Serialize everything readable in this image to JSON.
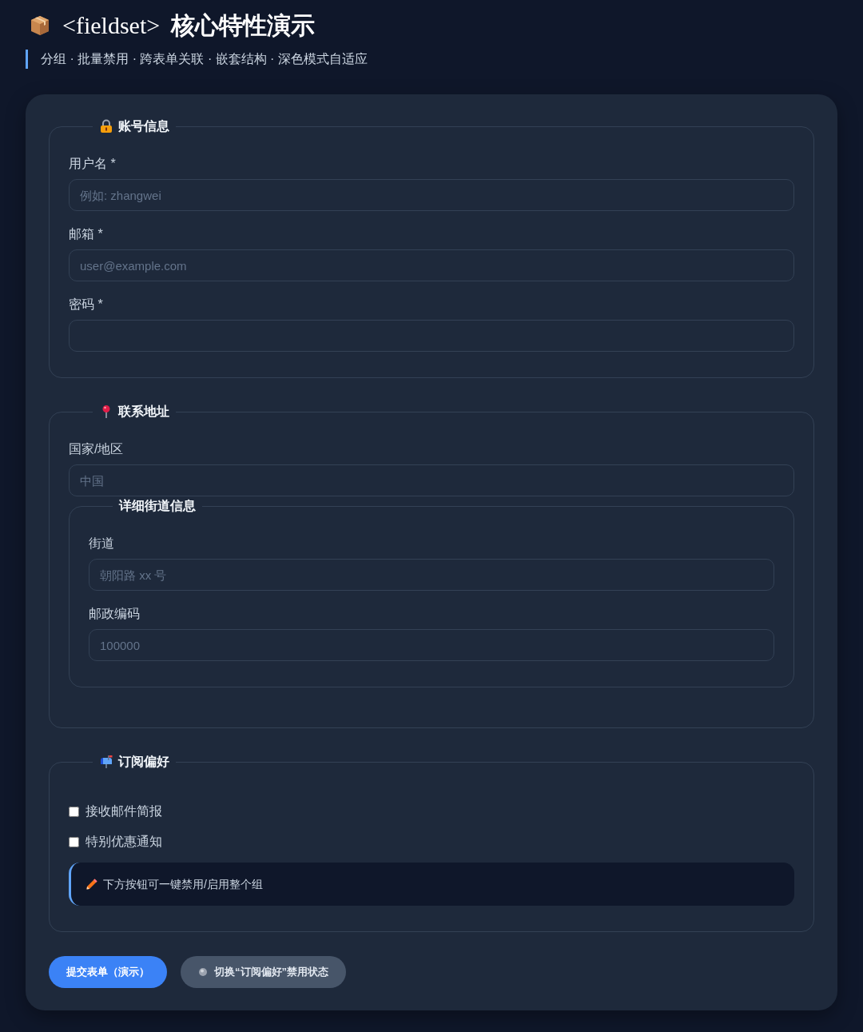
{
  "title_code": "<fieldset>",
  "title": "核心特性演示",
  "subtitle": "分组 · 批量禁用 · 跨表单关联 · 嵌套结构 · 深色模式自适应",
  "groups": [
    {
      "legend": "账号信息",
      "fields": [
        {
          "label": "用户名 *",
          "placeholder": "例如: zhangwei"
        },
        {
          "label": "邮箱 *",
          "placeholder": "user@example.com"
        },
        {
          "label": "密码 *"
        }
      ]
    },
    {
      "legend": "联系地址",
      "fields": [
        {
          "label": "国家/地区",
          "placeholder": "中国"
        }
      ],
      "subgroups": [
        {
          "legend": "详细街道信息",
          "fields": [
            {
              "label": "街道",
              "placeholder": "朝阳路 xx 号"
            },
            {
              "label": "邮政编码",
              "placeholder": "100000"
            }
          ]
        }
      ]
    },
    {
      "legend": "订阅偏好",
      "checkboxes": [
        {
          "label": "接收邮件简报",
          "checked": false
        },
        {
          "label": "特别优惠通知",
          "checked": false
        }
      ],
      "note": "下方按钮可一键禁用/启用整个组"
    }
  ],
  "buttons": [
    {
      "label": "提交表单（演示）",
      "kind": "primary"
    },
    {
      "label": "切换“订阅偏好”禁用状态",
      "kind": "toggle"
    }
  ]
}
